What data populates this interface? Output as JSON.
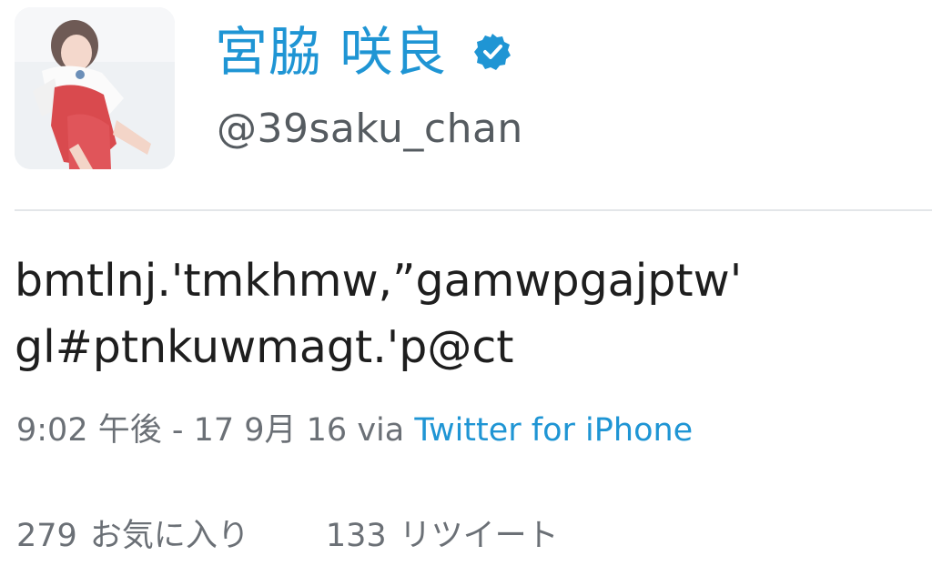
{
  "user": {
    "display_name": "宮脇 咲良",
    "username": "@39saku_chan",
    "verified": true
  },
  "tweet": {
    "text_lines": [
      "bmtlnj.'tmkhmw,”gamwpgajptw'",
      "gl#ptnkuwmagt.'p@ct"
    ],
    "timestamp": "9:02 午後 - 17 9月 16",
    "via_label": "via",
    "client": "Twitter for iPhone"
  },
  "stats": {
    "favorites_count": "279",
    "favorites_label": "お気に入り",
    "retweets_count": "133",
    "retweets_label": "リツイート"
  },
  "colors": {
    "link_blue": "#1f95d4",
    "meta_gray": "#6b7076",
    "text_dark": "#1e1e1e"
  },
  "icons": {
    "verified": "verified-badge-icon",
    "avatar": "profile-photo"
  }
}
